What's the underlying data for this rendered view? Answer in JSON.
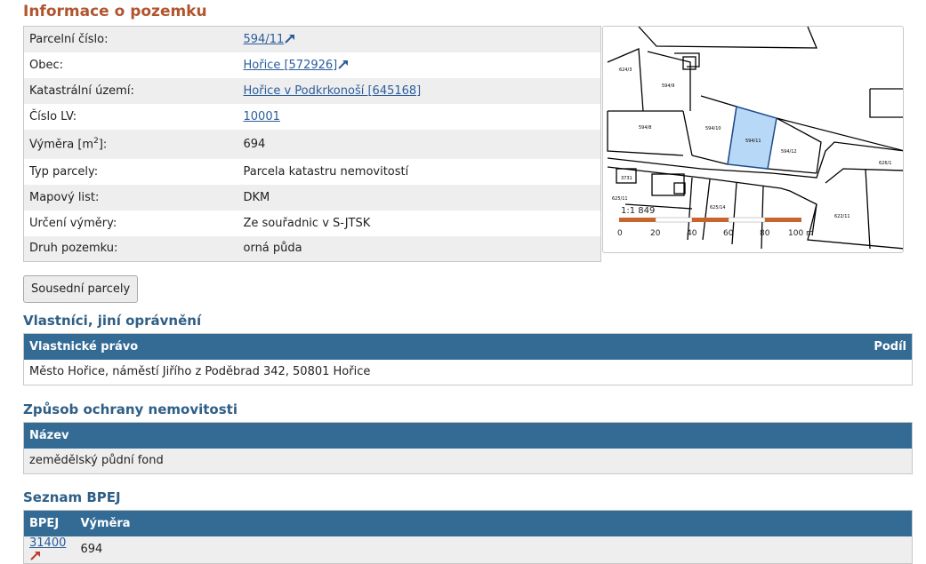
{
  "title": "Informace o pozemku",
  "info_rows": [
    {
      "label": "Parcelní číslo:",
      "value": "594/11",
      "link": true,
      "ext": true
    },
    {
      "label": "Obec:",
      "value": "Hořice [572926]",
      "link": true,
      "ext": true
    },
    {
      "label": "Katastrální území:",
      "value": "Hořice v Podkrkonoší [645168]",
      "link": true,
      "ext": false
    },
    {
      "label": "Číslo LV:",
      "value": "10001",
      "link": true,
      "ext": false
    },
    {
      "label_main": "Výměra [m",
      "label_sup": "2",
      "label_end": "]:",
      "value": "694"
    },
    {
      "label": "Typ parcely:",
      "value": "Parcela katastru nemovitostí"
    },
    {
      "label": "Mapový list:",
      "value": "DKM"
    },
    {
      "label": "Určení výměry:",
      "value": "Ze souřadnic v S-JTSK"
    },
    {
      "label": "Druh pozemku:",
      "value": "orná půda"
    }
  ],
  "map": {
    "scale_text": "1:1 849",
    "scale_labels": [
      "0",
      "20",
      "40",
      "60",
      "80",
      "100 m"
    ],
    "parcel_labels": [
      "594/11",
      "594/12",
      "594/10",
      "594/9",
      "594/8",
      "624/3",
      "625/11",
      "625/14",
      "622/11",
      "626/1",
      "3731"
    ],
    "highlight_color": "#b7d8f7",
    "scale_color": "#c8652a"
  },
  "neighbors_button": "Sousední parcely",
  "owners": {
    "title": "Vlastníci, jiní oprávnění",
    "headers": [
      "Vlastnické právo",
      "Podíl"
    ],
    "rows": [
      [
        "Město Hořice, náměstí Jiřího z Poděbrad 342, 50801 Hořice",
        ""
      ]
    ]
  },
  "protection": {
    "title": "Způsob ochrany nemovitosti",
    "header": "Název",
    "rows": [
      "zemědělský půdní fond"
    ]
  },
  "bpej": {
    "title": "Seznam BPEJ",
    "headers": [
      "BPEJ",
      "Výměra"
    ],
    "rows": [
      {
        "code": "31400",
        "area": "694"
      }
    ]
  },
  "colors": {
    "title": "#b1552f",
    "section_title": "#2f5f86",
    "table_header": "#336b95",
    "link": "#2a5d9c"
  }
}
